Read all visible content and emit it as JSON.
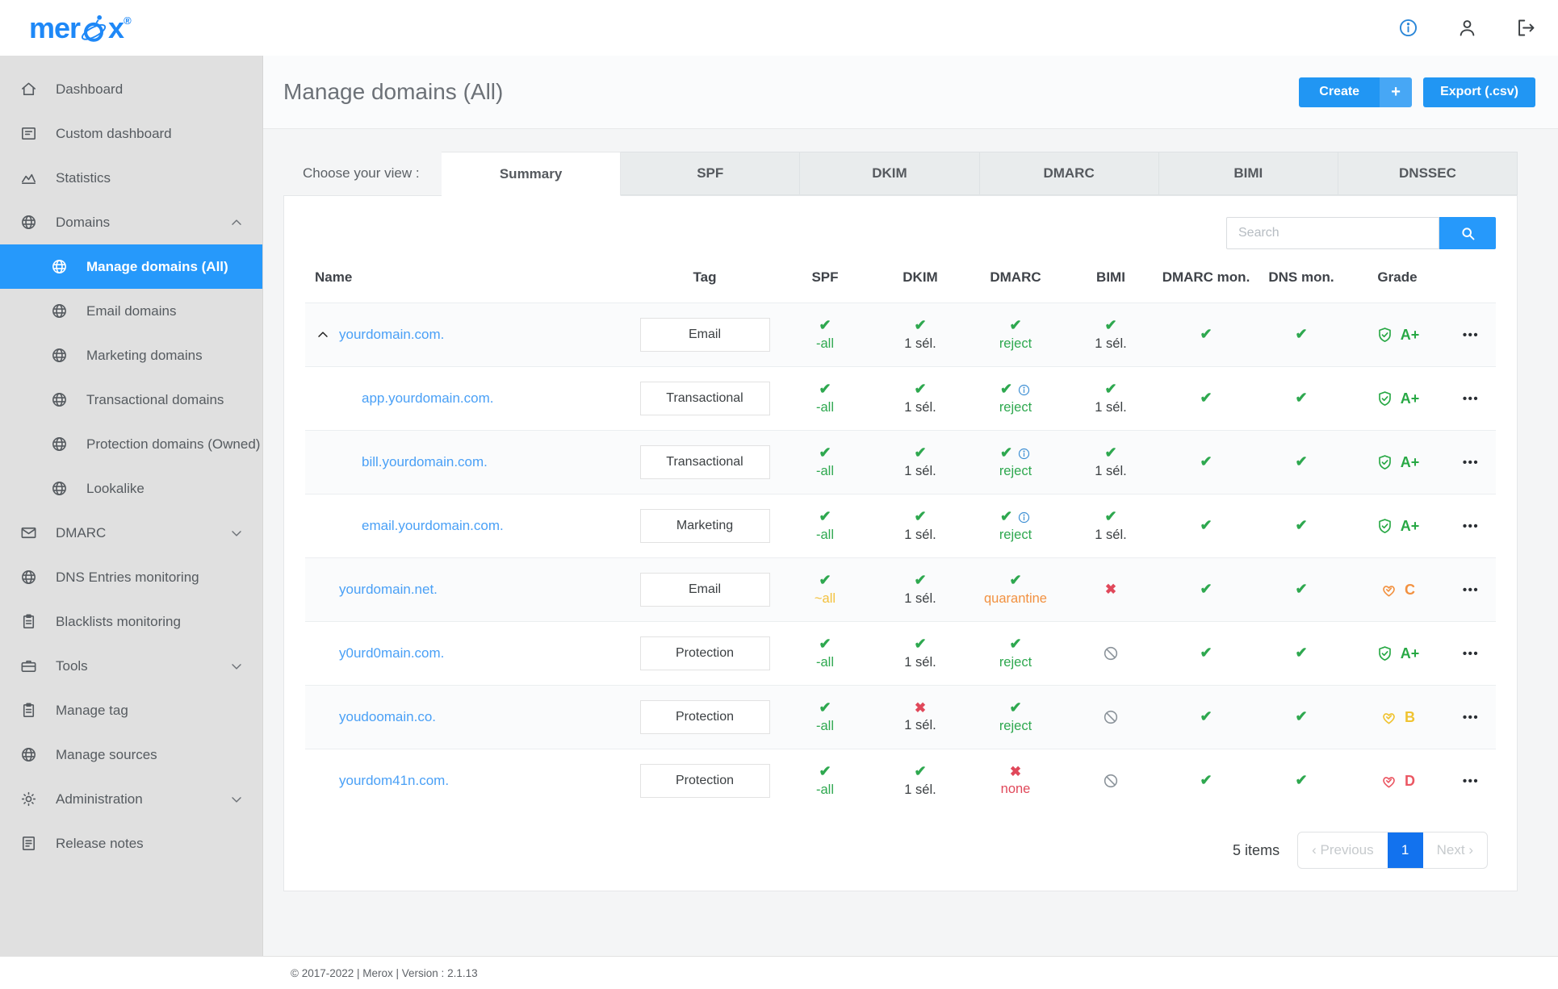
{
  "brand": {
    "logo_left": "mer",
    "logo_right": "x",
    "reg_mark": "®"
  },
  "topbar": {
    "icons": [
      "info-icon",
      "user-icon",
      "logout-icon"
    ]
  },
  "sidebar": {
    "items": [
      {
        "label": "Dashboard",
        "icon": "home"
      },
      {
        "label": "Custom dashboard",
        "icon": "panel"
      },
      {
        "label": "Statistics",
        "icon": "chart"
      },
      {
        "label": "Domains",
        "icon": "globe",
        "chevron": "up"
      },
      {
        "label": "Manage domains (All)",
        "icon": "globe",
        "child": true,
        "selected": true
      },
      {
        "label": "Email domains",
        "icon": "globe",
        "child": true
      },
      {
        "label": "Marketing domains",
        "icon": "globe",
        "child": true
      },
      {
        "label": "Transactional domains",
        "icon": "globe",
        "child": true
      },
      {
        "label": "Protection domains (Owned)",
        "icon": "globe",
        "child": true
      },
      {
        "label": "Lookalike",
        "icon": "globe",
        "child": true
      },
      {
        "label": "DMARC",
        "icon": "mail",
        "chevron": "down"
      },
      {
        "label": "DNS Entries monitoring",
        "icon": "globe"
      },
      {
        "label": "Blacklists monitoring",
        "icon": "clipboard"
      },
      {
        "label": "Tools",
        "icon": "case",
        "chevron": "down"
      },
      {
        "label": "Manage tag",
        "icon": "clipboard"
      },
      {
        "label": "Manage sources",
        "icon": "globe"
      },
      {
        "label": "Administration",
        "icon": "gear",
        "chevron": "down"
      },
      {
        "label": "Release notes",
        "icon": "note"
      }
    ]
  },
  "page": {
    "title": "Manage domains (All)",
    "create_label": "Create",
    "create_plus": "+",
    "export_label": "Export (.csv)"
  },
  "tabs": {
    "label": "Choose your view :",
    "items": [
      {
        "label": "Summary",
        "active": true
      },
      {
        "label": "SPF"
      },
      {
        "label": "DKIM"
      },
      {
        "label": "DMARC"
      },
      {
        "label": "BIMI"
      },
      {
        "label": "DNSSEC"
      }
    ]
  },
  "search": {
    "placeholder": "Search",
    "button_icon": "search-icon"
  },
  "table": {
    "columns": [
      {
        "label": "Name",
        "key": "name"
      },
      {
        "label": "Tag",
        "key": "tag"
      },
      {
        "label": "SPF",
        "key": "m"
      },
      {
        "label": "DKIM",
        "key": "m"
      },
      {
        "label": "DMARC",
        "key": "m"
      },
      {
        "label": "BIMI",
        "key": "m"
      },
      {
        "label": "DMARC mon.",
        "key": "m"
      },
      {
        "label": "DNS mon.",
        "key": "m"
      },
      {
        "label": "Grade",
        "key": "grade"
      },
      {
        "label": "",
        "key": "act"
      }
    ],
    "rows": [
      {
        "name": "yourdomain.com.",
        "child": false,
        "expander": true,
        "tag": "Email",
        "spf": {
          "mark": "check",
          "text": "-all",
          "cls": "green"
        },
        "dkim": {
          "mark": "check",
          "text": "1 sél.",
          "cls": "dark"
        },
        "dmarc": {
          "mark": "check",
          "info": false,
          "text": "reject",
          "cls": "green"
        },
        "bimi": {
          "mark": "check",
          "text": "1 sél.",
          "cls": "dark"
        },
        "dmarc_mon": {
          "mark": "check"
        },
        "dns_mon": {
          "mark": "check"
        },
        "grade": {
          "icon": "shield",
          "letter": "A+",
          "cls": "g-green"
        },
        "actions": "•••"
      },
      {
        "name": "app.yourdomain.com.",
        "child": true,
        "expander": false,
        "tag": "Transactional",
        "spf": {
          "mark": "check",
          "text": "-all",
          "cls": "green"
        },
        "dkim": {
          "mark": "check",
          "text": "1 sél.",
          "cls": "dark"
        },
        "dmarc": {
          "mark": "check",
          "info": true,
          "text": "reject",
          "cls": "green"
        },
        "bimi": {
          "mark": "check",
          "text": "1 sél.",
          "cls": "dark"
        },
        "dmarc_mon": {
          "mark": "check"
        },
        "dns_mon": {
          "mark": "check"
        },
        "grade": {
          "icon": "shield",
          "letter": "A+",
          "cls": "g-green"
        },
        "actions": "•••"
      },
      {
        "name": "bill.yourdomain.com.",
        "child": true,
        "expander": false,
        "tag": "Transactional",
        "spf": {
          "mark": "check",
          "text": "-all",
          "cls": "green"
        },
        "dkim": {
          "mark": "check",
          "text": "1 sél.",
          "cls": "dark"
        },
        "dmarc": {
          "mark": "check",
          "info": true,
          "text": "reject",
          "cls": "green"
        },
        "bimi": {
          "mark": "check",
          "text": "1 sél.",
          "cls": "dark"
        },
        "dmarc_mon": {
          "mark": "check"
        },
        "dns_mon": {
          "mark": "check"
        },
        "grade": {
          "icon": "shield",
          "letter": "A+",
          "cls": "g-green"
        },
        "actions": "•••"
      },
      {
        "name": "email.yourdomain.com.",
        "child": true,
        "expander": false,
        "tag": "Marketing",
        "spf": {
          "mark": "check",
          "text": "-all",
          "cls": "green"
        },
        "dkim": {
          "mark": "check",
          "text": "1 sél.",
          "cls": "dark"
        },
        "dmarc": {
          "mark": "check",
          "info": true,
          "text": "reject",
          "cls": "green"
        },
        "bimi": {
          "mark": "check",
          "text": "1 sél.",
          "cls": "dark"
        },
        "dmarc_mon": {
          "mark": "check"
        },
        "dns_mon": {
          "mark": "check"
        },
        "grade": {
          "icon": "shield",
          "letter": "A+",
          "cls": "g-green"
        },
        "actions": "•••"
      },
      {
        "name": "yourdomain.net.",
        "child": false,
        "expander": false,
        "tag": "Email",
        "spf": {
          "mark": "check",
          "text": "~all",
          "cls": "yellow"
        },
        "dkim": {
          "mark": "check",
          "text": "1 sél.",
          "cls": "dark"
        },
        "dmarc": {
          "mark": "check",
          "info": false,
          "text": "quarantine",
          "cls": "orange"
        },
        "bimi": {
          "mark": "cross"
        },
        "dmarc_mon": {
          "mark": "check"
        },
        "dns_mon": {
          "mark": "check"
        },
        "grade": {
          "icon": "heart",
          "letter": "C",
          "cls": "g-orange"
        },
        "actions": "•••"
      },
      {
        "name": "y0urd0main.com.",
        "child": false,
        "expander": false,
        "tag": "Protection",
        "spf": {
          "mark": "check",
          "text": "-all",
          "cls": "green"
        },
        "dkim": {
          "mark": "check",
          "text": "1 sél.",
          "cls": "dark"
        },
        "dmarc": {
          "mark": "check",
          "info": false,
          "text": "reject",
          "cls": "green"
        },
        "bimi": {
          "mark": "blocked"
        },
        "dmarc_mon": {
          "mark": "check"
        },
        "dns_mon": {
          "mark": "check"
        },
        "grade": {
          "icon": "shield",
          "letter": "A+",
          "cls": "g-green"
        },
        "actions": "•••"
      },
      {
        "name": "youdoomain.co.",
        "child": false,
        "expander": false,
        "tag": "Protection",
        "spf": {
          "mark": "check",
          "text": "-all",
          "cls": "green"
        },
        "dkim": {
          "mark": "cross",
          "text": "1 sél.",
          "cls": "dark"
        },
        "dmarc": {
          "mark": "check",
          "info": false,
          "text": "reject",
          "cls": "green"
        },
        "bimi": {
          "mark": "blocked"
        },
        "dmarc_mon": {
          "mark": "check"
        },
        "dns_mon": {
          "mark": "check"
        },
        "grade": {
          "icon": "heart",
          "letter": "B",
          "cls": "g-yellow"
        },
        "actions": "•••"
      },
      {
        "name": "yourdom41n.com.",
        "child": false,
        "expander": false,
        "tag": "Protection",
        "spf": {
          "mark": "check",
          "text": "-all",
          "cls": "green"
        },
        "dkim": {
          "mark": "check",
          "text": "1 sél.",
          "cls": "dark"
        },
        "dmarc": {
          "mark": "cross",
          "info": false,
          "text": "none",
          "cls": "red"
        },
        "bimi": {
          "mark": "blocked"
        },
        "dmarc_mon": {
          "mark": "check"
        },
        "dns_mon": {
          "mark": "check"
        },
        "grade": {
          "icon": "heart",
          "letter": "D",
          "cls": "g-red"
        },
        "actions": "•••"
      }
    ]
  },
  "pagination": {
    "count_label": "5 items",
    "prev_arrow": "‹",
    "prev_label": "Previous",
    "current_page": "1",
    "next_label": "Next",
    "next_arrow": "›"
  },
  "footer": {
    "copyright": "© 2017-2022 | Merox | Version : 2.1.13"
  },
  "colors": {
    "accent_blue": "#2196f3",
    "selected_sidebar_blue": "#2699fb",
    "link_blue": "#4aa0f6",
    "success_green": "#2ea84f",
    "warning_yellow": "#f3c03c",
    "warning_orange": "#f29140",
    "error_red": "#e0485a",
    "sidebar_gray": "#e0e0e0",
    "content_gray": "#f4f5f6"
  }
}
